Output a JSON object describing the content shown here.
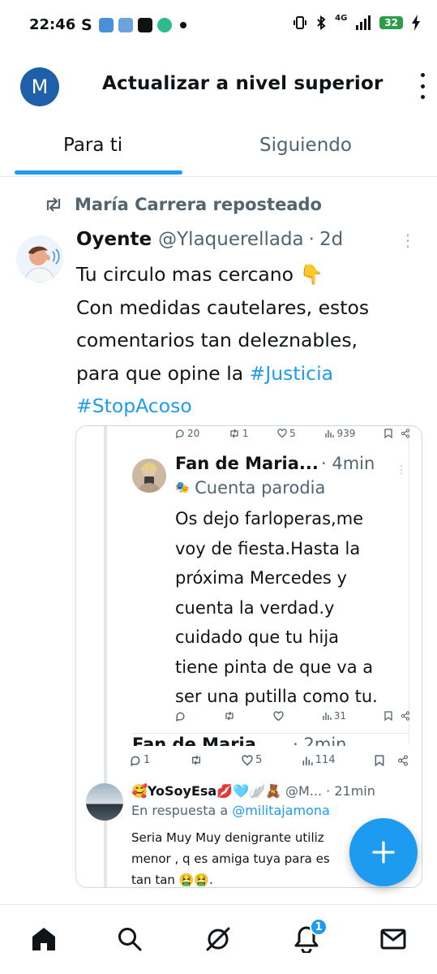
{
  "status_bar": {
    "time": "22:46",
    "carrier_icon": "S",
    "network": "4G",
    "battery": "32"
  },
  "header": {
    "avatar_letter": "M",
    "title": "Actualizar a nivel superior",
    "menu_icon": "more-vertical-icon"
  },
  "tabs": [
    {
      "label": "Para ti",
      "active": true
    },
    {
      "label": "Siguiendo",
      "active": false
    }
  ],
  "repost": {
    "label": "María Carrera reposteado"
  },
  "tweet": {
    "name": "Oyente",
    "handle": "@Ylaquerellada",
    "dot": "·",
    "time": "2d",
    "text_lines": [
      "Tu circulo mas cercano 👇",
      "Con medidas cautelares, estos",
      "comentarios tan deleznables,",
      "para que opine la "
    ],
    "hashtag_justicia": "#Justicia",
    "hashtag_stopacoso": "#StopAcoso"
  },
  "screenshot": {
    "top_actions": {
      "replies": "20",
      "reposts": "1",
      "likes": "5",
      "views": "939"
    },
    "inner_tweet": {
      "name": "Fan de Maria...",
      "time": "· 4min",
      "label": "Cuenta parodia",
      "text_lines": [
        "Os dejo farloperas,me",
        "voy de fiesta.Hasta la",
        "próxima Mercedes y",
        "cuenta la verdad.y",
        "cuidado que tu hija",
        "tiene pinta de que va a",
        "ser una putilla como tu."
      ],
      "views": "31"
    },
    "cut_name": "Fan de Maria...",
    "cut_time": "· 2min",
    "row_actions": {
      "replies": "1",
      "likes": "5",
      "views": "114"
    },
    "reply": {
      "name": "🥰YoSoyEsa💋🩵🪽🧸",
      "handle": "@M...",
      "time": "· 21min",
      "in_reply_prefix": "En respuesta a ",
      "in_reply_mention": "@militajamona",
      "text_lines": [
        "Seria Muy Muy denigrante utiliz",
        "menor , q es amiga tuya para es",
        "tan tan 🤮🤮."
      ]
    }
  },
  "fab": {
    "icon": "plus-icon"
  },
  "bottom_nav": {
    "items": [
      "home-icon",
      "search-icon",
      "grok-icon",
      "notifications-icon",
      "messages-icon"
    ],
    "notification_count": "1"
  },
  "colors": {
    "accent": "#1d9bf0",
    "text": "#0f1419",
    "muted": "#536471",
    "avatar_bg": "#1d5fa8"
  }
}
